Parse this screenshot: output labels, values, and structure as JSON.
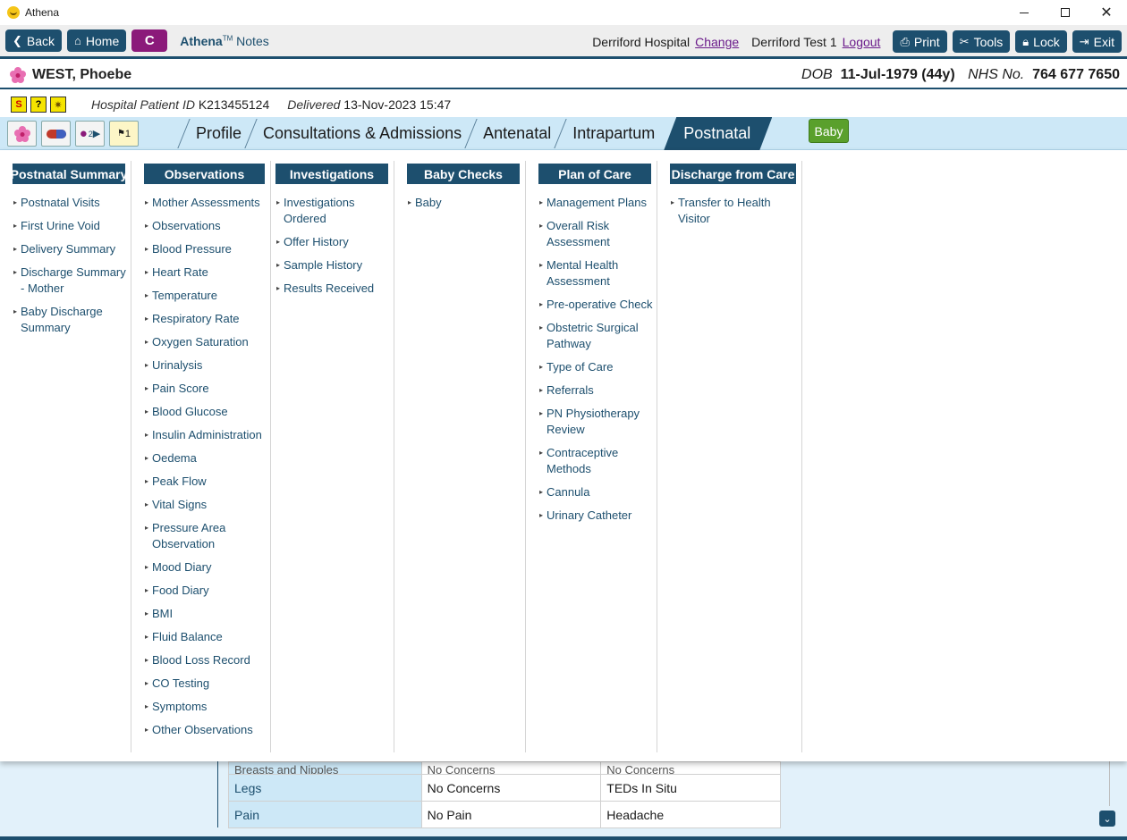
{
  "window": {
    "title": "Athena"
  },
  "toolbar": {
    "back": "Back",
    "home": "Home",
    "c_button": "C",
    "brand_name": "Athena",
    "brand_tm": "TM",
    "brand_suffix": " Notes",
    "hospital": "Derriford Hospital",
    "change": "Change",
    "user": "Derriford Test 1",
    "logout": "Logout",
    "print": "Print",
    "tools": "Tools",
    "lock": "Lock",
    "exit": "Exit"
  },
  "patient": {
    "name": "WEST, Phoebe",
    "dob_label": "DOB",
    "dob": "11-Jul-1979 (44y)",
    "nhs_label": "NHS No.",
    "nhs": "764 677 7650"
  },
  "info": {
    "hospital_id_label": "Hospital Patient ID",
    "hospital_id": "K213455124",
    "delivered_label": "Delivered",
    "delivered": "13-Nov-2023 15:47"
  },
  "tabs": [
    {
      "label": "Profile"
    },
    {
      "label": "Consultations & Admissions"
    },
    {
      "label": "Antenatal"
    },
    {
      "label": "Intrapartum"
    },
    {
      "label": "Postnatal"
    }
  ],
  "baby_button": "Baby",
  "tab_icon_badges": {
    "pills_count": "2",
    "notes_count": "1"
  },
  "menu": {
    "postnatal_summary": {
      "title": "Postnatal Summary",
      "items": [
        "Postnatal Visits",
        "First Urine Void",
        "Delivery Summary",
        "Discharge Summary - Mother",
        "Baby Discharge Summary"
      ]
    },
    "observations": {
      "title": "Observations",
      "items": [
        "Mother Assessments",
        "Observations",
        "Blood Pressure",
        "Heart Rate",
        "Temperature",
        "Respiratory Rate",
        "Oxygen Saturation",
        "Urinalysis",
        "Pain Score",
        "Blood Glucose",
        "Insulin Administration",
        "Oedema",
        "Peak Flow",
        "Vital Signs",
        "Pressure Area Observation",
        "Mood Diary",
        "Food Diary",
        "BMI",
        "Fluid Balance",
        "Blood Loss Record",
        "CO Testing",
        "Symptoms",
        "Other Observations"
      ]
    },
    "investigations": {
      "title": "Investigations",
      "items": [
        "Investigations Ordered",
        "Offer History",
        "Sample History",
        "Results Received"
      ]
    },
    "baby_checks": {
      "title": "Baby Checks",
      "items": [
        "Baby"
      ]
    },
    "plan_of_care": {
      "title": "Plan of Care",
      "items": [
        "Management Plans",
        "Overall Risk Assessment",
        "Mental Health Assessment",
        "Pre-operative Check",
        "Obstetric Surgical Pathway",
        "Type of Care",
        "Referrals",
        "PN Physiotherapy Review",
        "Contraceptive Methods",
        "Cannula",
        "Urinary Catheter"
      ]
    },
    "discharge": {
      "title": "Discharge from Care",
      "items": [
        "Transfer to Health Visitor"
      ]
    }
  },
  "background_table": [
    {
      "label": "Breasts and Nipples",
      "a": "No Concerns",
      "b": "No Concerns"
    },
    {
      "label": "Legs",
      "a": "No Concerns",
      "b": "TEDs In Situ"
    },
    {
      "label": "Pain",
      "a": "No Pain",
      "b": "Headache"
    }
  ]
}
